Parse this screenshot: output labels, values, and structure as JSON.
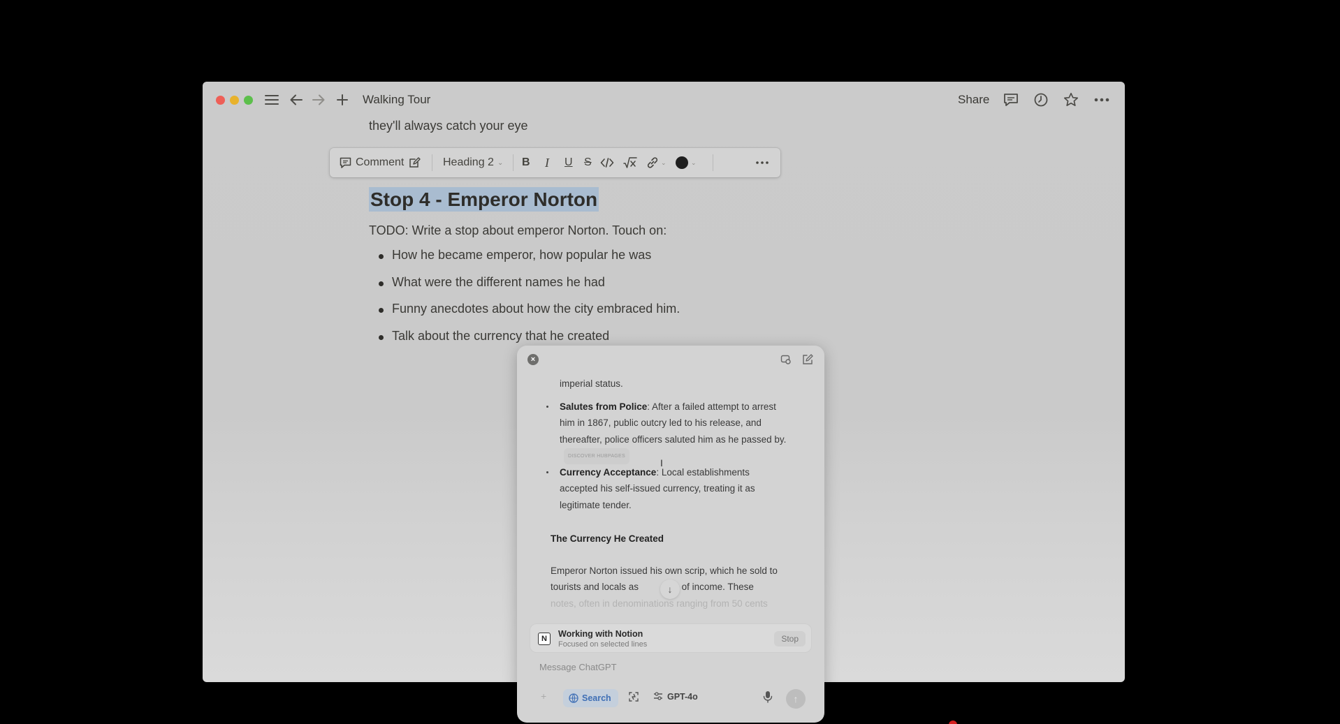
{
  "window": {
    "title": "Walking Tour",
    "share_label": "Share"
  },
  "editor": {
    "previous_line": "they'll always catch your eye",
    "heading": "Stop 4 - Emperor Norton",
    "todo": "TODO: Write a stop about emperor Norton. Touch on:",
    "bullets": [
      "How he became emperor, how popular he was",
      "What were the different names he had",
      "Funny anecdotes about how the city embraced him.",
      "Talk about the currency that he created"
    ]
  },
  "format_toolbar": {
    "comment_label": "Comment",
    "block_type": "Heading 2",
    "text_color": "#1f1f1f"
  },
  "chatgpt_panel": {
    "content": {
      "partial_line": "imperial status.",
      "bullets": [
        {
          "title": "Salutes from Police",
          "text": ": After a failed attempt to arrest him in 1867, public outcry led to his release, and thereafter, police officers saluted him as he passed by.",
          "source_tag": "DISCOVER HUBPAGES"
        },
        {
          "title": "Currency Acceptance",
          "text": ": Local establishments accepted his self-issued currency, treating it as legitimate tender."
        }
      ],
      "section_title": "The Currency He Created",
      "paragraph_a": "Emperor Norton issued his own scrip, which he sold to tourists and locals as",
      "paragraph_b": "ans of income. These",
      "paragraph_faded": "notes, often in denominations ranging from 50 cents"
    },
    "context_card": {
      "title": "Working with Notion",
      "subtitle": "Focused on selected lines",
      "stop_label": "Stop"
    },
    "input_placeholder": "Message ChatGPT",
    "search_label": "Search",
    "model_label": "GPT-4o",
    "accent_color": "#3f6fb5"
  },
  "colors": {
    "selection_highlight": "#a9bcd0",
    "traffic_red": "#ee5f57",
    "traffic_yellow": "#e8b22c",
    "traffic_green": "#5cbf4b"
  }
}
